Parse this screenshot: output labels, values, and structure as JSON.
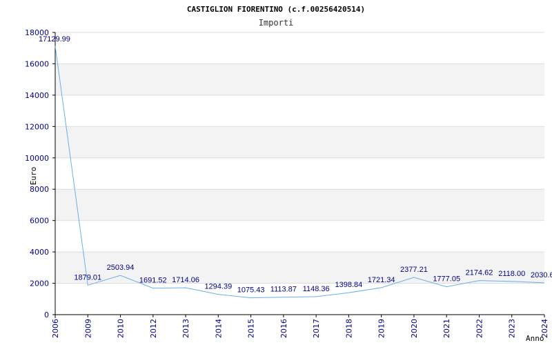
{
  "chart_data": {
    "type": "line",
    "title": "CASTIGLION FIORENTINO (c.f.00256420514)",
    "subtitle": "Importi",
    "xlabel": "Anno",
    "ylabel": "Euro",
    "ylim": [
      0,
      18000
    ],
    "yticks": [
      0,
      2000,
      4000,
      6000,
      8000,
      10000,
      12000,
      14000,
      16000,
      18000
    ],
    "grid": true,
    "categories": [
      "2006",
      "2009",
      "2010",
      "2012",
      "2013",
      "2014",
      "2015",
      "2016",
      "2017",
      "2018",
      "2019",
      "2020",
      "2021",
      "2022",
      "2023",
      "2024"
    ],
    "values": [
      17129.99,
      1879.01,
      2503.94,
      1691.52,
      1714.06,
      1294.39,
      1075.43,
      1113.87,
      1148.36,
      1398.84,
      1721.34,
      2377.21,
      1777.05,
      2174.62,
      2118.0,
      2030.6
    ],
    "data_labels": [
      "17129.99",
      "1879.01",
      "2503.94",
      "1691.52",
      "1714.06",
      "1294.39",
      "1075.43",
      "1113.87",
      "1148.36",
      "1398.84",
      "1721.34",
      "2377.21",
      "1777.05",
      "2174.62",
      "2118.00",
      "2030.6"
    ],
    "colors": {
      "line": "#6aaee8",
      "band": "#f3f3f3",
      "grid": "#dddddd",
      "axis": "#000000",
      "tick_text": "#00008b"
    }
  }
}
